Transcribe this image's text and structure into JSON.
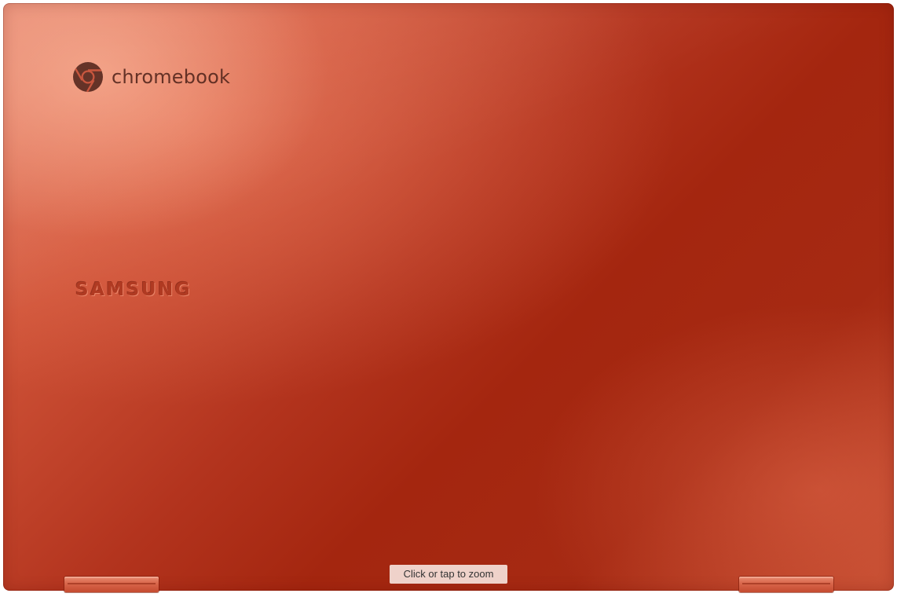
{
  "product_image": {
    "chrome_logo": {
      "icon": "chrome-logo-icon",
      "wordmark": "chromebook"
    },
    "brand_logo": "SAMSUNG",
    "colors": {
      "lid_primary": "#a4260f",
      "lid_highlight": "#e07a62",
      "logo_text": "#5a2418"
    }
  },
  "zoom_hint": {
    "label": "Click or tap to zoom"
  }
}
